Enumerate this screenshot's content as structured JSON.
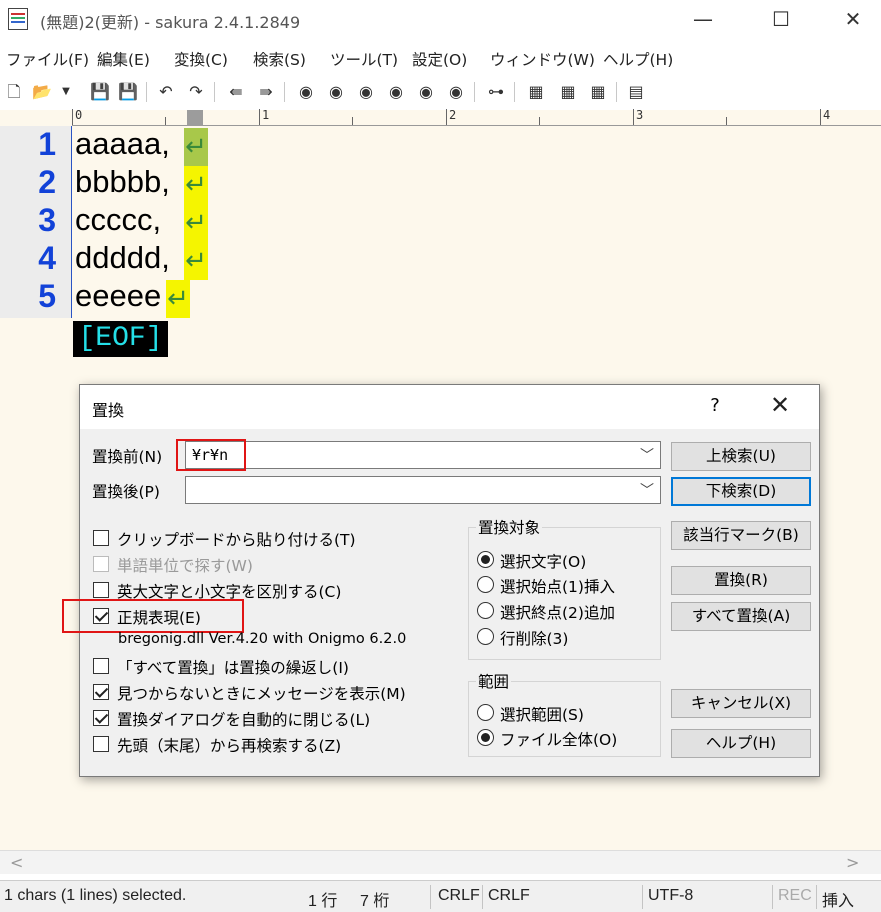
{
  "window": {
    "title": "(無題)2(更新) - sakura 2.4.1.2849",
    "minimize": "—",
    "maximize": "☐",
    "close": "✕"
  },
  "menu": [
    {
      "label": "ファイル(F)"
    },
    {
      "label": "編集(E)"
    },
    {
      "label": "変換(C)"
    },
    {
      "label": "検索(S)"
    },
    {
      "label": "ツール(T)"
    },
    {
      "label": "設定(O)"
    },
    {
      "label": "ウィンドウ(W)"
    },
    {
      "label": "ヘルプ(H)"
    }
  ],
  "ruler": {
    "marks": [
      "0",
      "1",
      "2",
      "3",
      "4"
    ]
  },
  "editor": {
    "lines": [
      {
        "num": "1",
        "text": "aaaaa,"
      },
      {
        "num": "2",
        "text": "bbbbb,"
      },
      {
        "num": "3",
        "text": "ccccc,"
      },
      {
        "num": "4",
        "text": "ddddd,"
      },
      {
        "num": "5",
        "text": "eeeee"
      }
    ],
    "eol_glyph": "↵",
    "eof": "[EOF]"
  },
  "dialog": {
    "title": "置換",
    "help": "?",
    "close": "✕",
    "find_label": "置換前(N)",
    "find_value": "¥r¥n",
    "replace_label": "置換後(P)",
    "replace_value": "",
    "combo_arrow": "﹀",
    "options": [
      {
        "label": "クリップボードから貼り付ける(T)",
        "checked": false,
        "disabled": false
      },
      {
        "label": "単語単位で探す(W)",
        "checked": false,
        "disabled": true
      },
      {
        "label": "英大文字と小文字を区別する(C)",
        "checked": false,
        "disabled": false
      },
      {
        "label": "正規表現(E)",
        "checked": true,
        "disabled": false
      },
      {
        "label": "「すべて置換」は置換の繰返し(I)",
        "checked": false,
        "disabled": false
      },
      {
        "label": "見つからないときにメッセージを表示(M)",
        "checked": true,
        "disabled": false
      },
      {
        "label": "置換ダイアログを自動的に閉じる(L)",
        "checked": true,
        "disabled": false
      },
      {
        "label": "先頭（末尾）から再検索する(Z)",
        "checked": false,
        "disabled": false
      }
    ],
    "regex_lib": "bregonig.dll Ver.4.20 with Onigmo 6.2.0",
    "target_group": {
      "title": "置換対象",
      "options": [
        {
          "label": "選択文字(O)",
          "checked": true
        },
        {
          "label": "選択始点(1)挿入",
          "checked": false
        },
        {
          "label": "選択終点(2)追加",
          "checked": false
        },
        {
          "label": "行削除(3)",
          "checked": false
        }
      ]
    },
    "scope_group": {
      "title": "範囲",
      "options": [
        {
          "label": "選択範囲(S)",
          "checked": false
        },
        {
          "label": "ファイル全体(O)",
          "checked": true
        }
      ]
    },
    "buttons": {
      "search_up": "上検索(U)",
      "search_down": "下検索(D)",
      "mark_lines": "該当行マーク(B)",
      "replace": "置換(R)",
      "replace_all": "すべて置換(A)",
      "cancel": "キャンセル(X)",
      "help": "ヘルプ(H)"
    }
  },
  "status": {
    "selection": "1 chars (1 lines) selected.",
    "line": "1 行",
    "column": "7 桁",
    "eol1": "CRLF",
    "eol2": "CRLF",
    "encoding": "UTF-8",
    "rec": "REC",
    "mode": "挿入"
  },
  "colors": {
    "line_number": "#1242d8",
    "eol_highlight": "#f5f500",
    "eof_text": "#25e0e8",
    "editor_bg": "#fdf8ec",
    "annotation_red": "#e01515"
  }
}
